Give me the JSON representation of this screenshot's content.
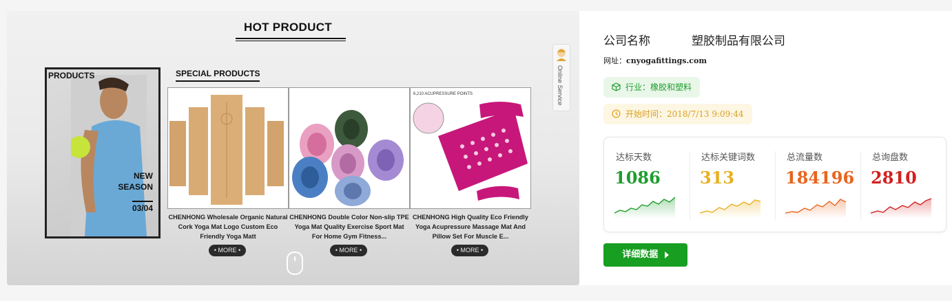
{
  "showcase": {
    "hot_title": "HOT PRODUCT",
    "promo": {
      "label": "PRODUCTS",
      "season_new": "NEW",
      "season_word": "SEASON",
      "date": "03/04"
    },
    "special_title": "SPECIAL PRODUCTS",
    "products": [
      {
        "caption": "CHENHONG Wholesale Organic Natural Cork Yoga Mat Logo Custom Eco Friendly Yoga Matt",
        "more": "• MORE •"
      },
      {
        "caption": "CHENHONG Double Color Non-slip TPE Yoga Mat Quality Exercise Sport Mat For Home Gym Fitness...",
        "more": "• MORE •"
      },
      {
        "caption": "CHENHONG High Quality Eco Friendly Yoga Acupressure Massage Mat And Pillow Set For Muscle E...",
        "more": "• MORE •"
      }
    ],
    "acupressure_note": "6,210 ACUPRESSURE POINTS",
    "online_service": "Online Service"
  },
  "company": {
    "name_prefix": "公司名称",
    "name_suffix": "塑胶制品有限公司",
    "website_label": "网址：",
    "website_value": "cnyogafittings.com",
    "industry": "行业：橡胶和塑料",
    "start_time": "开始时间：2018/7/13 9:09:44"
  },
  "stats": [
    {
      "label": "达标天数",
      "value": "1086",
      "color": "#1f9d2e"
    },
    {
      "label": "达标关键词数",
      "value": "313",
      "color": "#e8b020"
    },
    {
      "label": "总流量数",
      "value": "184196",
      "color": "#e8651e"
    },
    {
      "label": "总询盘数",
      "value": "2810",
      "color": "#d31f1f"
    }
  ],
  "detail_button": "详细数据"
}
